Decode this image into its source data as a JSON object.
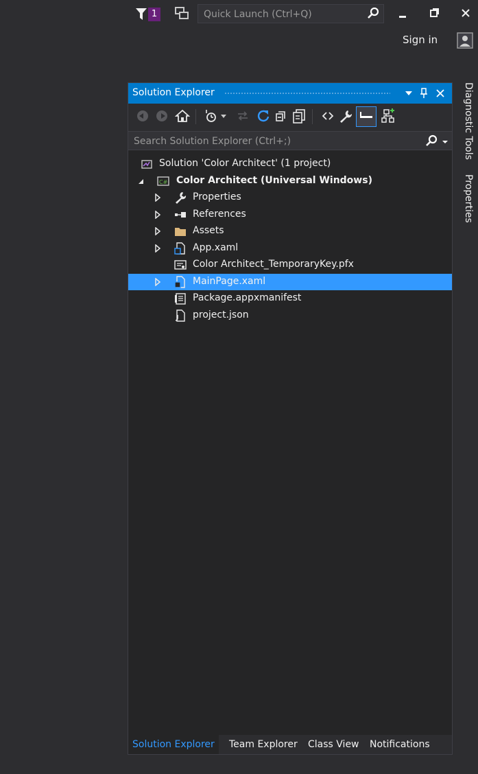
{
  "titlebar": {
    "filter_count": "1",
    "quick_launch_placeholder": "Quick Launch (Ctrl+Q)",
    "sign_in_label": "Sign in"
  },
  "side_tabs": [
    "Diagnostic Tools",
    "Properties"
  ],
  "solution_explorer": {
    "title": "Solution Explorer",
    "search_placeholder": "Search Solution Explorer (Ctrl+;)",
    "tree": [
      {
        "label": "Solution 'Color Architect' (1 project)",
        "icon": "solution-icon",
        "expander": "none"
      },
      {
        "label": "Color Architect (Universal Windows)",
        "icon": "csharp-project-icon",
        "expander": "expanded"
      },
      {
        "label": "Properties",
        "icon": "wrench-icon",
        "expander": "collapsed"
      },
      {
        "label": "References",
        "icon": "references-icon",
        "expander": "collapsed"
      },
      {
        "label": "Assets",
        "icon": "folder-icon",
        "expander": "collapsed"
      },
      {
        "label": "App.xaml",
        "icon": "xaml-file-icon",
        "expander": "collapsed"
      },
      {
        "label": "Color Architect_TemporaryKey.pfx",
        "icon": "certificate-icon",
        "expander": "none"
      },
      {
        "label": "MainPage.xaml",
        "icon": "xaml-file-icon",
        "expander": "collapsed",
        "selected": true
      },
      {
        "label": "Package.appxmanifest",
        "icon": "manifest-icon",
        "expander": "none"
      },
      {
        "label": "project.json",
        "icon": "json-file-icon",
        "expander": "none"
      }
    ],
    "bottom_tabs": [
      "Solution Explorer",
      "Team Explorer",
      "Class View",
      "Notifications"
    ],
    "active_tab": "Solution Explorer"
  },
  "colors": {
    "background": "#2d2d30",
    "panel": "#252526",
    "accent": "#007acc",
    "selection": "#3399ff",
    "badge": "#68217a"
  }
}
